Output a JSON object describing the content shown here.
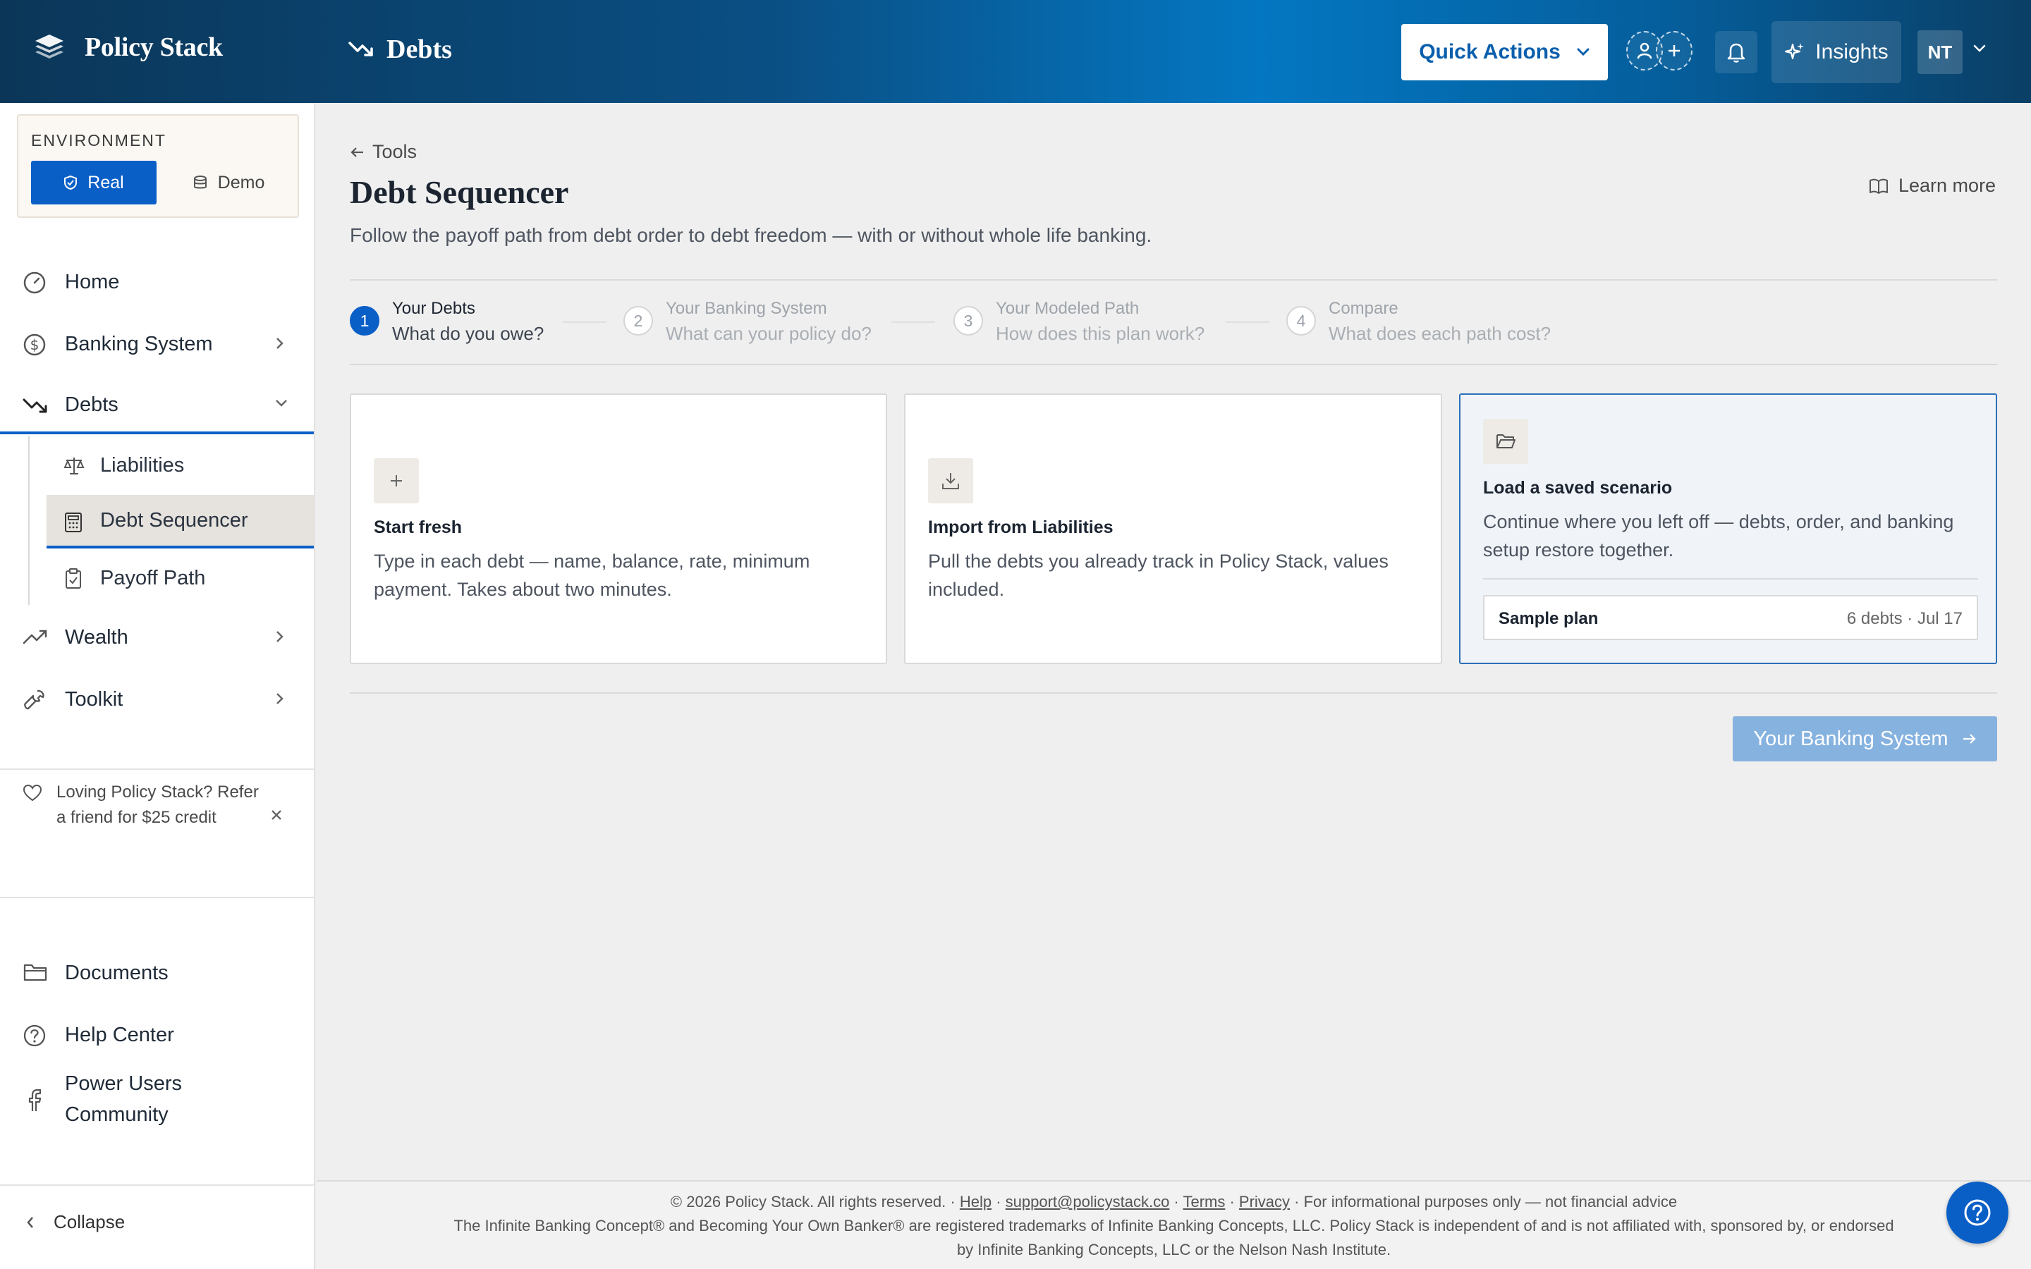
{
  "header": {
    "brand": "Policy Stack",
    "page": "Debts",
    "quick_actions": "Quick Actions",
    "insights": "Insights",
    "avatar_initials": "NT"
  },
  "sidebar": {
    "environment_label": "ENVIRONMENT",
    "env_real": "Real",
    "env_demo": "Demo",
    "nav": {
      "home": "Home",
      "banking_system": "Banking System",
      "debts": "Debts",
      "liabilities": "Liabilities",
      "debt_sequencer": "Debt Sequencer",
      "payoff_path": "Payoff Path",
      "wealth": "Wealth",
      "toolkit": "Toolkit",
      "documents": "Documents",
      "help_center": "Help Center",
      "power_users": "Power Users Community"
    },
    "refer_text": "Loving Policy Stack? Refer a friend for $25 credit",
    "collapse": "Collapse"
  },
  "main": {
    "back_link": "Tools",
    "title": "Debt Sequencer",
    "subtitle": "Follow the payoff path from debt order to debt freedom — with or without whole life banking.",
    "learn_more": "Learn more",
    "steps": [
      {
        "num": "1",
        "title": "Your Debts",
        "sub": "What do you owe?"
      },
      {
        "num": "2",
        "title": "Your Banking System",
        "sub": "What can your policy do?"
      },
      {
        "num": "3",
        "title": "Your Modeled Path",
        "sub": "How does this plan work?"
      },
      {
        "num": "4",
        "title": "Compare",
        "sub": "What does each path cost?"
      }
    ],
    "cards": [
      {
        "title": "Start fresh",
        "desc": "Type in each debt — name, balance, rate, minimum payment. Takes about two minutes."
      },
      {
        "title": "Import from Liabilities",
        "desc": "Pull the debts you already track in Policy Stack, values included."
      },
      {
        "title": "Load a saved scenario",
        "desc": "Continue where you left off — debts, order, and banking setup restore together."
      }
    ],
    "saved_plan": {
      "name": "Sample plan",
      "meta": "6 debts · Jul 17"
    },
    "next_button": "Your Banking System"
  },
  "footer": {
    "copyright": "© 2026 Policy Stack. All rights reserved.",
    "sep": " · ",
    "help": "Help",
    "email": "support@policystack.co",
    "terms": "Terms",
    "privacy": "Privacy",
    "disclaimer": "For informational purposes only — not financial advice",
    "trademark": "The Infinite Banking Concept® and Becoming Your Own Banker® are registered trademarks of Infinite Banking Concepts, LLC. Policy Stack is independent of and is not affiliated with, sponsored by, or endorsed by Infinite Banking Concepts, LLC or the Nelson Nash Institute."
  },
  "colors": {
    "accent": "#0a5fc7",
    "header_dark": "#0b3658",
    "header_light": "#0477c2"
  }
}
